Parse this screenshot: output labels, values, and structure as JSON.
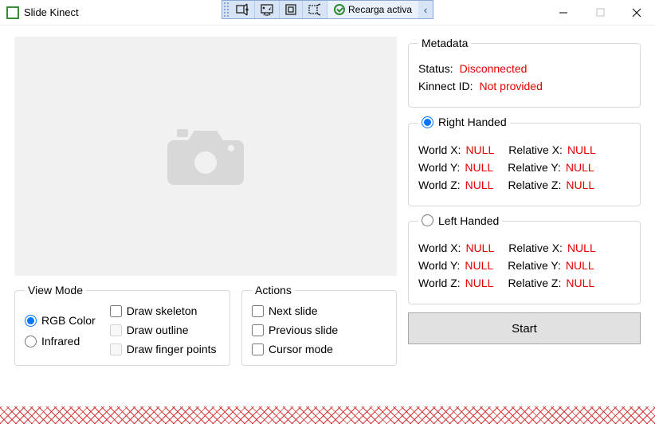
{
  "title": "Slide Kinect",
  "titlebar": {
    "reload_status": "Recarga activa"
  },
  "viewmode": {
    "legend": "View Mode",
    "rgb": "RGB Color",
    "infrared": "Infrared",
    "draw_skeleton": "Draw skeleton",
    "draw_outline": "Draw outline",
    "draw_finger": "Draw finger points"
  },
  "actions": {
    "legend": "Actions",
    "next": "Next slide",
    "prev": "Previous slide",
    "cursor": "Cursor mode"
  },
  "metadata": {
    "legend": "Metadata",
    "status_label": "Status:",
    "status_value": "Disconnected",
    "id_label": "Kinnect ID:",
    "id_value": "Not provided"
  },
  "right_hand": {
    "legend": "Right Handed",
    "selected": true,
    "rows": [
      {
        "wl": "World X:",
        "wv": "NULL",
        "rl": "Relative X:",
        "rv": "NULL"
      },
      {
        "wl": "World Y:",
        "wv": "NULL",
        "rl": "Relative Y:",
        "rv": "NULL"
      },
      {
        "wl": "World Z:",
        "wv": "NULL",
        "rl": "Relative Z:",
        "rv": "NULL"
      }
    ]
  },
  "left_hand": {
    "legend": "Left Handed",
    "selected": false,
    "rows": [
      {
        "wl": "World X:",
        "wv": "NULL",
        "rl": "Relative X:",
        "rv": "NULL"
      },
      {
        "wl": "World Y:",
        "wv": "NULL",
        "rl": "Relative Y:",
        "rv": "NULL"
      },
      {
        "wl": "World Z:",
        "wv": "NULL",
        "rl": "Relative Z:",
        "rv": "NULL"
      }
    ]
  },
  "start_label": "Start"
}
